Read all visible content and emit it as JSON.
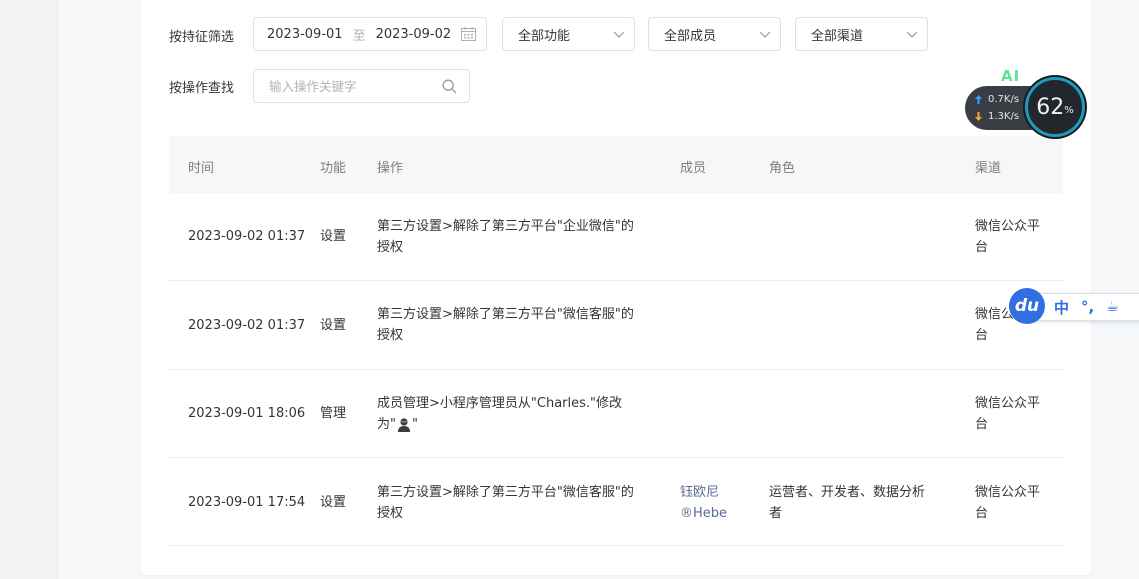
{
  "filters": {
    "feature_label": "按持征筛选",
    "date_start": "2023-09-01",
    "date_separator": "至",
    "date_end": "2023-09-02",
    "function_select": "全部功能",
    "member_select": "全部成员",
    "channel_select": "全部渠道",
    "op_label": "按操作查找",
    "op_placeholder": "输入操作关键字"
  },
  "table": {
    "headers": {
      "time": "时间",
      "function": "功能",
      "operation": "操作",
      "member": "成员",
      "role": "角色",
      "channel": "渠道"
    },
    "rows": [
      {
        "time": "2023-09-02 01:37",
        "function": "设置",
        "operation_l1": "第三方设置>解除了第三方平台\"企业微信\"的",
        "operation_l2": "授权",
        "member_l1": "",
        "member_l2": "",
        "role_l1": "",
        "role_l2": "",
        "channel_l1": "微信公众平",
        "channel_l2": "台"
      },
      {
        "time": "2023-09-02 01:37",
        "function": "设置",
        "operation_l1": "第三方设置>解除了第三方平台\"微信客服\"的",
        "operation_l2": "授权",
        "member_l1": "",
        "member_l2": "",
        "role_l1": "",
        "role_l2": "",
        "channel_l1": "微信公众平",
        "channel_l2": "台"
      },
      {
        "time": "2023-09-01 18:06",
        "function": "管理",
        "operation_l1": "成员管理>小程序管理员从\"Charles.\"修改",
        "operation_l2_prefix": "为\"",
        "operation_l2_suffix": "\"",
        "member_l1": "",
        "member_l2": "",
        "role_l1": "",
        "role_l2": "",
        "channel_l1": "微信公众平",
        "channel_l2": "台"
      },
      {
        "time": "2023-09-01 17:54",
        "function": "设置",
        "operation_l1": "第三方设置>解除了第三方平台\"微信客服\"的",
        "operation_l2": "授权",
        "member_l1": "钰欧尼",
        "member_l2": "®Hebe",
        "role_l1": "运营者、开发者、数据分析",
        "role_l2": "者",
        "channel_l1": "微信公众平",
        "channel_l2": "台"
      }
    ]
  },
  "net_widget": {
    "ai": "AI",
    "upload": "0.7K/s",
    "download": "1.3K/s",
    "percent": "62",
    "percent_unit": "%"
  },
  "ime": {
    "logo": "du",
    "mode": "中",
    "punct": "°,",
    "cup": "☕"
  },
  "colors": {
    "accent_link": "#576b95",
    "gauge_ring": "#1f9ab8",
    "ime_blue": "#2f6fe0"
  }
}
